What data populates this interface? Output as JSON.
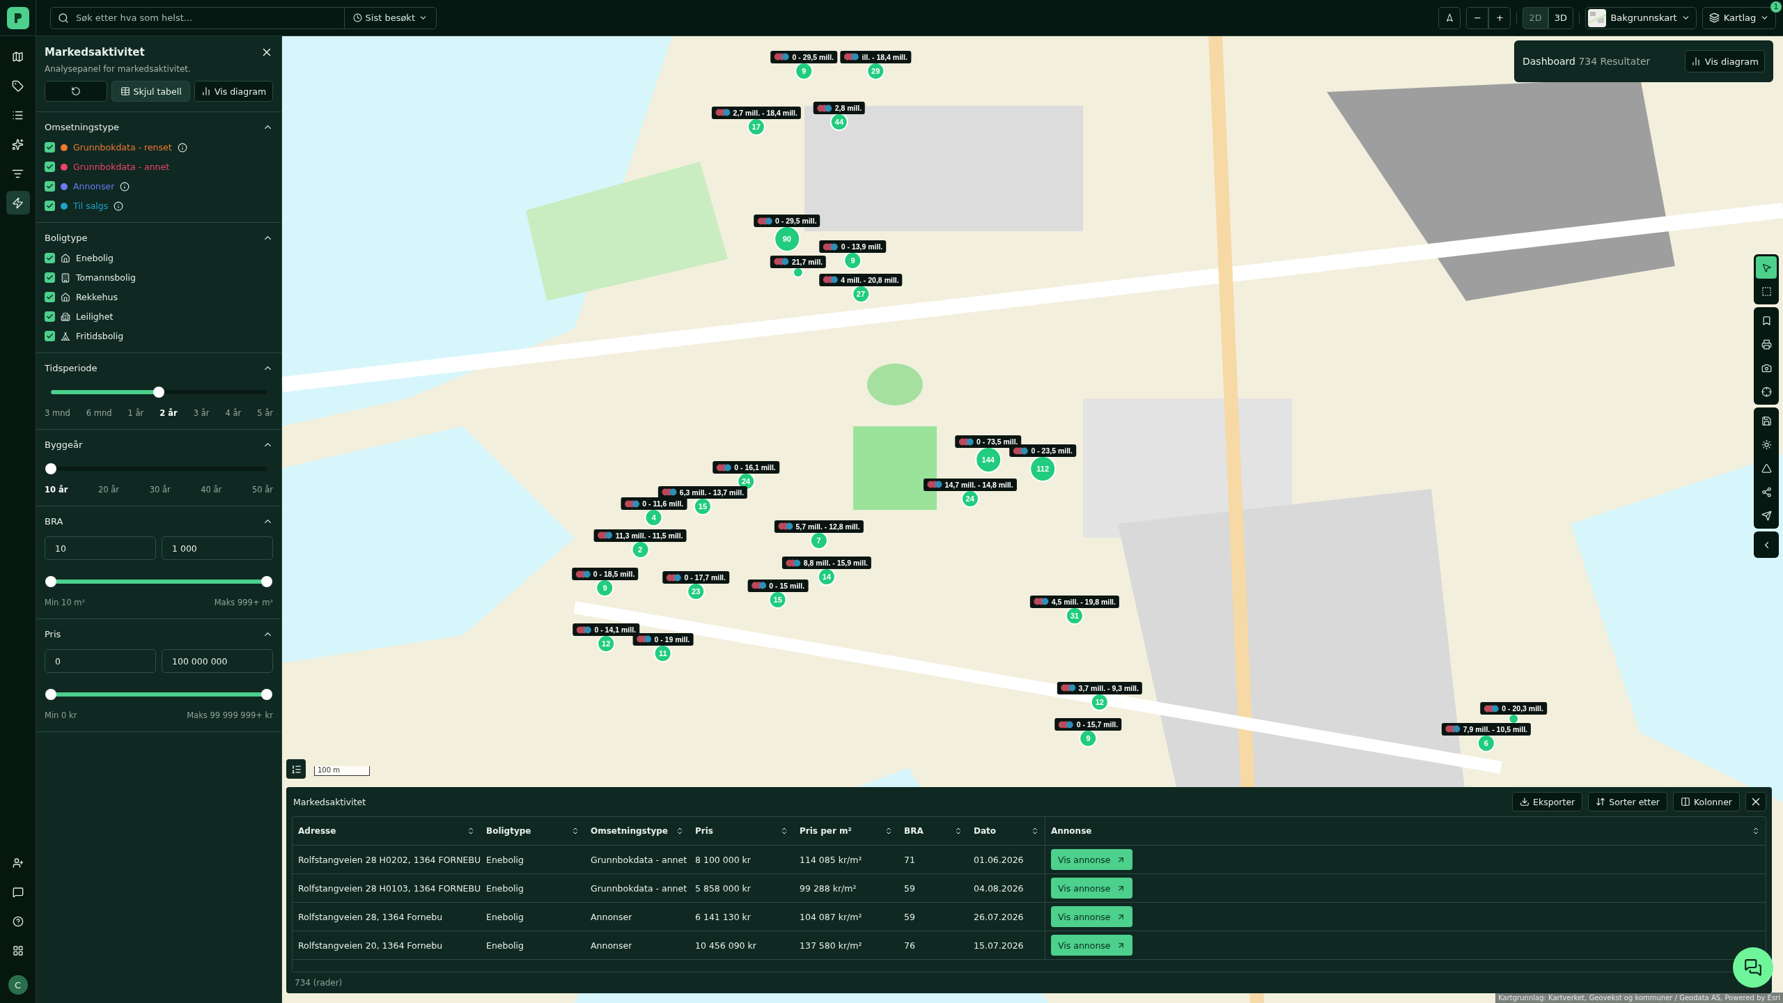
{
  "topbar": {
    "search": {
      "placeholder": "Søk etter hva som helst..."
    },
    "recent": "Sist besøkt",
    "zoom_out": "−",
    "zoom_in": "+",
    "view_modes": [
      {
        "label": "2D",
        "selected": true
      },
      {
        "label": "3D",
        "selected": false
      }
    ],
    "basemap": "Bakgrunnskart",
    "layers": {
      "label": "Kartlag",
      "badge": "1"
    }
  },
  "rail": {
    "items": [
      {
        "selected": false
      },
      {
        "selected": false
      },
      {
        "selected": false
      },
      {
        "selected": false
      },
      {
        "selected": false
      },
      {
        "selected": true
      }
    ],
    "bottom_items": [
      {
        "selected": false
      },
      {
        "selected": false
      },
      {
        "selected": false
      },
      {
        "selected": false
      }
    ],
    "avatar": "C"
  },
  "panel": {
    "title": "Markedsaktivitet",
    "subtitle": "Analysepanel for markedsaktivitet.",
    "buttons": [
      "Skjul tabell",
      "Vis diagram"
    ],
    "sections": [
      {
        "kind": "types",
        "title": "Omsetningstype",
        "expanded": true,
        "items": [
          {
            "label": "Grunnbokdata - renset",
            "checked": true,
            "color": "#f07a2f",
            "info": true
          },
          {
            "label": "Grunnbokdata - annet",
            "checked": true,
            "color": "#ec4466",
            "info": false
          },
          {
            "label": "Annonser",
            "checked": true,
            "color": "#6b7bf2",
            "info": true
          },
          {
            "label": "Til salgs",
            "checked": true,
            "color": "#1fa3c6",
            "info": true
          }
        ]
      },
      {
        "kind": "housing",
        "title": "Boligtype",
        "expanded": true,
        "items": [
          {
            "label": "Enebolig",
            "checked": true
          },
          {
            "label": "Tomannsbolig",
            "checked": true
          },
          {
            "label": "Rekkehus",
            "checked": true
          },
          {
            "label": "Leilighet",
            "checked": true
          },
          {
            "label": "Fritidsbolig",
            "checked": true
          }
        ]
      },
      {
        "kind": "steps",
        "title": "Tidsperiode",
        "expanded": true,
        "level": 0.5,
        "ticks": [
          {
            "label": "3 mnd",
            "selected": false
          },
          {
            "label": "6 mnd",
            "selected": false
          },
          {
            "label": "1 år",
            "selected": false
          },
          {
            "label": "2 år",
            "selected": true
          },
          {
            "label": "3 år",
            "selected": false
          },
          {
            "label": "4 år",
            "selected": false
          },
          {
            "label": "5 år",
            "selected": false
          }
        ]
      },
      {
        "kind": "steps",
        "title": "Byggeår",
        "expanded": true,
        "level": 0,
        "ticks": [
          {
            "label": "10 år",
            "selected": true
          },
          {
            "label": "20 år",
            "selected": false
          },
          {
            "label": "30 år",
            "selected": false
          },
          {
            "label": "40 år",
            "selected": false
          },
          {
            "label": "50 år",
            "selected": false
          }
        ]
      },
      {
        "kind": "range",
        "title": "BRA",
        "expanded": true,
        "min_value": "10",
        "max_value": "1 000",
        "thumbs": [
          {
            "level": 0
          },
          {
            "level": 1
          }
        ],
        "min_label": "Min 10 m²",
        "max_label": "Maks 999+ m²"
      },
      {
        "kind": "range",
        "title": "Pris",
        "expanded": true,
        "min_value": "0",
        "max_value": "100 000 000",
        "thumbs": [
          {
            "level": 0
          },
          {
            "level": 1
          }
        ],
        "min_label": "Min 0 kr",
        "max_label": "Maks 99 999 999+ kr"
      }
    ]
  },
  "dashboard": {
    "title": "Dashboard",
    "count": "734 Resultater",
    "button": "Vis diagram"
  },
  "map_tools": [
    {
      "selected": true
    },
    {
      "selected": false
    },
    {
      "selected": false
    },
    {
      "selected": false
    },
    {
      "selected": false
    },
    {
      "selected": false
    },
    {
      "selected": false
    },
    {
      "selected": false
    },
    {
      "selected": false
    },
    {
      "selected": false
    },
    {
      "selected": false
    },
    {
      "selected": false
    }
  ],
  "markers": [
    {
      "label": "0 - 29,5 mill.",
      "count": "9"
    },
    {
      "label": "ill. - 18,4 mill.",
      "count": "29"
    },
    {
      "label": "2,7 mill. - 18,4 mill.",
      "count": "17"
    },
    {
      "label": "2,8 mill.",
      "count": "44"
    },
    {
      "label": "0 - 29,5 mill.",
      "count": "90"
    },
    {
      "label": "0 - 13,9 mill.",
      "count": "9"
    },
    {
      "label": "21,7 mill."
    },
    {
      "label": "4 mill. - 20,8 mill.",
      "count": "27"
    },
    {
      "label": "0 - 73,5 mill.",
      "count": "144"
    },
    {
      "label": "0 - 23,5 mill.",
      "count": "112"
    },
    {
      "label": "14,7 mill. - 14,8 mill.",
      "count": "24"
    },
    {
      "label": "0 - 16,1 mill.",
      "count": "24"
    },
    {
      "label": "6,3 mill. - 13,7 mill.",
      "count": "15"
    },
    {
      "label": "0 - 11,6 mill.",
      "count": "4"
    },
    {
      "label": "5,7 mill. - 12,8 mill.",
      "count": "7"
    },
    {
      "label": "11,3 mill. - 11,5 mill.",
      "count": "2"
    },
    {
      "label": "8,8 mill. - 15,9 mill.",
      "count": "14"
    },
    {
      "label": "0 - 18,5 mill.",
      "count": "9"
    },
    {
      "label": "0 - 17,7 mill.",
      "count": "23"
    },
    {
      "label": "0 - 15 mill.",
      "count": "15"
    },
    {
      "label": "4,5 mill. - 19,8 mill.",
      "count": "31"
    },
    {
      "label": "0 - 14,1 mill.",
      "count": "12"
    },
    {
      "label": "0 - 19 mill.",
      "count": "11"
    },
    {
      "label": "3,7 mill. - 9,3 mill.",
      "count": "12"
    },
    {
      "label": "0 - 15,7 mill.",
      "count": "9"
    },
    {
      "label": "0 - 20,3 mill."
    },
    {
      "label": "7,9 mill. - 10,5 mill.",
      "count": "6"
    }
  ],
  "scale": "100 m",
  "attribution": "Kartgrunnlag: Kartverket, Geovekst og kommuner / Geodata AS, Powered by Esri",
  "table": {
    "title": "Markedsaktivitet",
    "actions": [
      "Eksporter",
      "Sorter etter",
      "Kolonner"
    ],
    "columns": [
      "Adresse",
      "Boligtype",
      "Omsetningstype",
      "Pris",
      "Pris per m²",
      "BRA",
      "Dato",
      "Annonse"
    ],
    "rows": [
      {
        "cells": [
          "Rolfstangveien 28 H0202, 1364 FORNEBU",
          "Enebolig",
          "Grunnbokdata - annet",
          "8 100 000 kr",
          "114 085 kr/m²",
          "71",
          "01.06.2026"
        ],
        "link": "Vis annonse"
      },
      {
        "cells": [
          "Rolfstangveien 28 H0103, 1364 FORNEBU",
          "Enebolig",
          "Grunnbokdata - annet",
          "5 858 000 kr",
          "99 288 kr/m²",
          "59",
          "04.08.2026"
        ],
        "link": "Vis annonse"
      },
      {
        "cells": [
          "Rolfstangveien 28, 1364 Fornebu",
          "Enebolig",
          "Annonser",
          "6 141 130 kr",
          "104 087 kr/m²",
          "59",
          "26.07.2026"
        ],
        "link": "Vis annonse"
      },
      {
        "cells": [
          "Rolfstangveien 20, 1364 Fornebu",
          "Enebolig",
          "Annonser",
          "10 456 090 kr",
          "137 580 kr/m²",
          "76",
          "15.07.2026"
        ],
        "link": "Vis annonse"
      }
    ],
    "footer": "734 (rader)"
  }
}
